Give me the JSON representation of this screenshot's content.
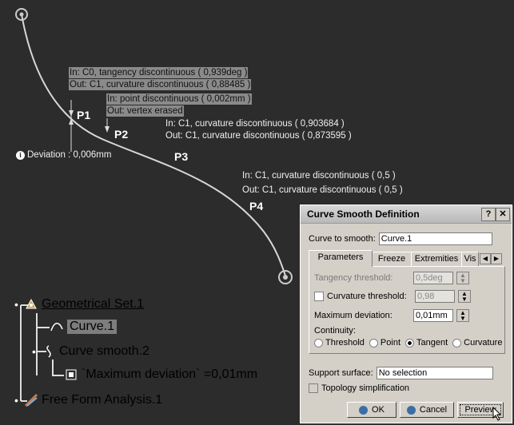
{
  "annotations": {
    "p1": {
      "in": "In: C0, tangency discontinuous ( 0,939deg )",
      "out": "Out: C1, curvature discontinuous ( 0,88485 )",
      "label": "P1"
    },
    "p2": {
      "in": "In: point discontinuous ( 0,002mm )",
      "out": "Out: vertex erased",
      "label": "P2"
    },
    "p3": {
      "in": "In: C1, curvature discontinuous ( 0,903684 )",
      "out": "Out: C1, curvature discontinuous ( 0,873595 )",
      "label": "P3"
    },
    "p4": {
      "in": "In: C1, curvature discontinuous ( 0,5 )",
      "out": "Out: C1, curvature discontinuous ( 0,5 )",
      "label": "P4"
    },
    "deviation": "Deviation : 0,006mm"
  },
  "tree": {
    "geometrical_set": "Geometrical Set.1",
    "curve": "Curve.1",
    "curve_smooth": "Curve smooth.2",
    "max_deviation": "`Maximum deviation` =0,01mm",
    "analysis": "Free Form Analysis.1"
  },
  "dialog": {
    "title": "Curve Smooth Definition",
    "help": "?",
    "close": "✕",
    "curve_to_smooth_label": "Curve to smooth:",
    "curve_to_smooth_value": "Curve.1",
    "tabs": [
      "Parameters",
      "Freeze",
      "Extremities",
      "Vis"
    ],
    "tangency_label": "Tangency threshold:",
    "tangency_value": "0,5deg",
    "curvature_label": "Curvature threshold:",
    "curvature_value": "0,98",
    "maxdev_label": "Maximum deviation:",
    "maxdev_value": "0,01mm",
    "continuity_label": "Continuity:",
    "continuity_options": [
      "Threshold",
      "Point",
      "Tangent",
      "Curvature"
    ],
    "continuity_selected": "Tangent",
    "support_label": "Support surface:",
    "support_value": "No selection",
    "topology_label": "Topology simplification",
    "ok": "OK",
    "cancel": "Cancel",
    "preview": "Preview"
  }
}
